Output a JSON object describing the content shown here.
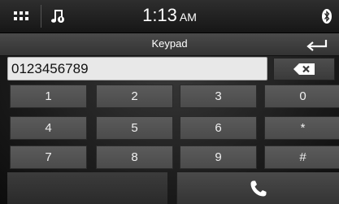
{
  "status_bar": {
    "time": "1:13",
    "ampm": "AM",
    "menu_icon": "grid-menu-icon",
    "music_icon": "music-note-icon",
    "bluetooth_icon": "bluetooth-icon"
  },
  "title_bar": {
    "title": "Keypad",
    "back_icon": "back-arrow-icon"
  },
  "number_field": {
    "value": "0123456789"
  },
  "delete_icon": "backspace-icon",
  "keys": [
    {
      "label": "1",
      "name": "key-1"
    },
    {
      "label": "2",
      "name": "key-2"
    },
    {
      "label": "3",
      "name": "key-3"
    },
    {
      "label": "0",
      "name": "key-0"
    },
    {
      "label": "4",
      "name": "key-4"
    },
    {
      "label": "5",
      "name": "key-5"
    },
    {
      "label": "6",
      "name": "key-6"
    },
    {
      "label": "*",
      "name": "key-star"
    },
    {
      "label": "7",
      "name": "key-7"
    },
    {
      "label": "8",
      "name": "key-8"
    },
    {
      "label": "9",
      "name": "key-9"
    },
    {
      "label": "#",
      "name": "key-hash"
    }
  ],
  "call_icon": "phone-icon",
  "colors": {
    "background": "#1c1c1c",
    "key": "#555555",
    "text": "#ffffff"
  }
}
